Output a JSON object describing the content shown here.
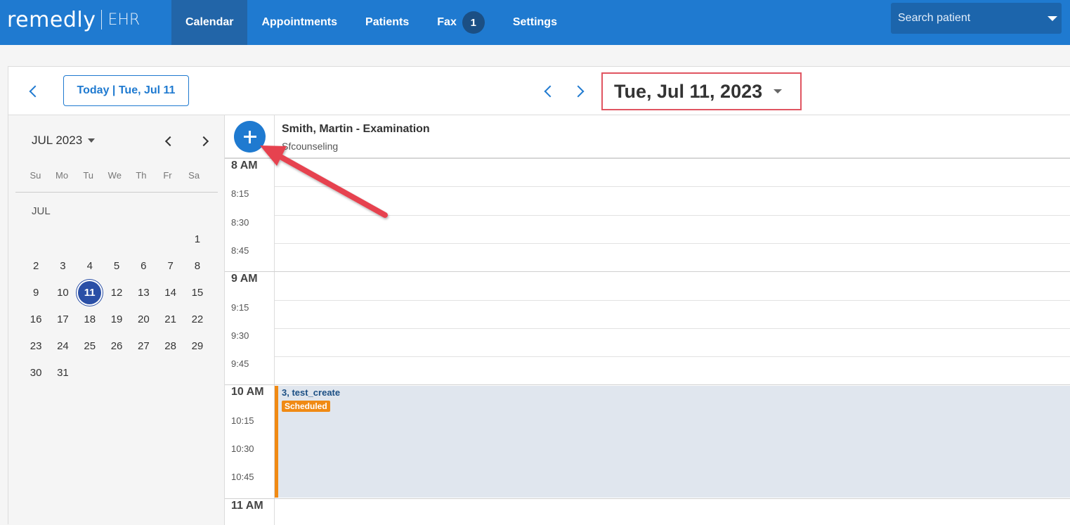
{
  "app": {
    "logo_text": "remedly",
    "logo_sub": "EHR"
  },
  "nav": {
    "items": [
      {
        "label": "Calendar",
        "active": true
      },
      {
        "label": "Appointments"
      },
      {
        "label": "Patients"
      },
      {
        "label": "Fax",
        "badge": "1"
      },
      {
        "label": "Settings"
      }
    ]
  },
  "search": {
    "placeholder": "Search patient"
  },
  "toolbar": {
    "today_label": "Today | Tue, Jul 11",
    "current_date": "Tue, Jul 11, 2023"
  },
  "mini_calendar": {
    "month_label": "JUL 2023",
    "weekdays": [
      "Su",
      "Mo",
      "Tu",
      "We",
      "Th",
      "Fr",
      "Sa"
    ],
    "month_short": "JUL",
    "weeks": [
      [
        "",
        "",
        "",
        "",
        "",
        "",
        "1"
      ],
      [
        "2",
        "3",
        "4",
        "5",
        "6",
        "7",
        "8"
      ],
      [
        "9",
        "10",
        "11",
        "12",
        "13",
        "14",
        "15"
      ],
      [
        "16",
        "17",
        "18",
        "19",
        "20",
        "21",
        "22"
      ],
      [
        "23",
        "24",
        "25",
        "26",
        "27",
        "28",
        "29"
      ],
      [
        "30",
        "31",
        "",
        "",
        "",
        "",
        ""
      ]
    ],
    "selected_day": "11"
  },
  "schedule": {
    "provider_name": "Smith, Martin - Examination",
    "provider_sub": "Sfcounseling",
    "times": [
      {
        "label": "8 AM",
        "hour": true
      },
      {
        "label": "8:15"
      },
      {
        "label": "8:30"
      },
      {
        "label": "8:45"
      },
      {
        "label": "9 AM",
        "hour": true
      },
      {
        "label": "9:15"
      },
      {
        "label": "9:30"
      },
      {
        "label": "9:45"
      },
      {
        "label": "10 AM",
        "hour": true
      },
      {
        "label": "10:15"
      },
      {
        "label": "10:30"
      },
      {
        "label": "10:45"
      },
      {
        "label": "11 AM",
        "hour": true
      }
    ],
    "appointment": {
      "title": "3, test_create",
      "status": "Scheduled"
    }
  },
  "colors": {
    "brand": "#1f7ad0",
    "selected_day": "#2a4fa6",
    "status_scheduled": "#f08a14",
    "annotation": "#e05561"
  }
}
